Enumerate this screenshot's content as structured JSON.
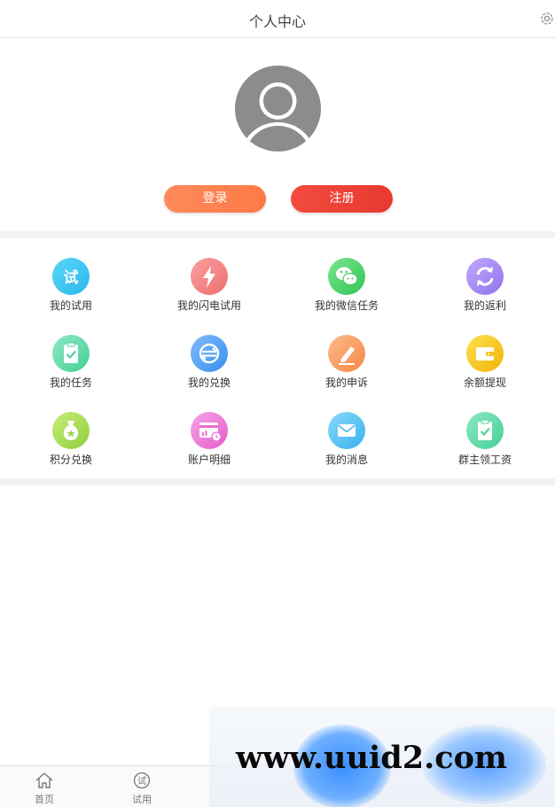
{
  "header": {
    "title": "个人中心",
    "settings_icon": "gear-icon"
  },
  "profile": {
    "avatar_icon": "user-avatar-icon",
    "login_label": "登录",
    "register_label": "注册"
  },
  "colors": {
    "login": "#ff7f50",
    "register": "#ee4236",
    "separator": "#f2f2f2"
  },
  "menu": [
    {
      "label": "我的试用",
      "icon": "trial-icon",
      "color": "#3cc8f0"
    },
    {
      "label": "我的闪电试用",
      "icon": "lightning-icon",
      "color": "#f47c7c"
    },
    {
      "label": "我的微信任务",
      "icon": "wechat-icon",
      "color": "#4cd36a"
    },
    {
      "label": "我的返利",
      "icon": "refresh-icon",
      "color": "#a78bf5"
    },
    {
      "label": "我的任务",
      "icon": "clipboard-check-icon",
      "color": "#5ed9a8"
    },
    {
      "label": "我的兑换",
      "icon": "exchange-icon",
      "color": "#4a9ff5"
    },
    {
      "label": "我的申诉",
      "icon": "pencil-icon",
      "color": "#fb9a58"
    },
    {
      "label": "余额提现",
      "icon": "wallet-icon",
      "color": "#f7c21e"
    },
    {
      "label": "积分兑换",
      "icon": "money-bag-icon",
      "color": "#a6dc5c"
    },
    {
      "label": "账户明细",
      "icon": "statement-icon",
      "color": "#f27ad8"
    },
    {
      "label": "我的消息",
      "icon": "envelope-icon",
      "color": "#5cc6f5"
    },
    {
      "label": "群主领工资",
      "icon": "clipboard-check-icon",
      "color": "#5ed9a8"
    }
  ],
  "tabbar": [
    {
      "label": "首页",
      "icon": "home-icon"
    },
    {
      "label": "试用",
      "icon": "trial-tab-icon"
    }
  ],
  "watermark": {
    "text": "www.uuid2.com"
  }
}
